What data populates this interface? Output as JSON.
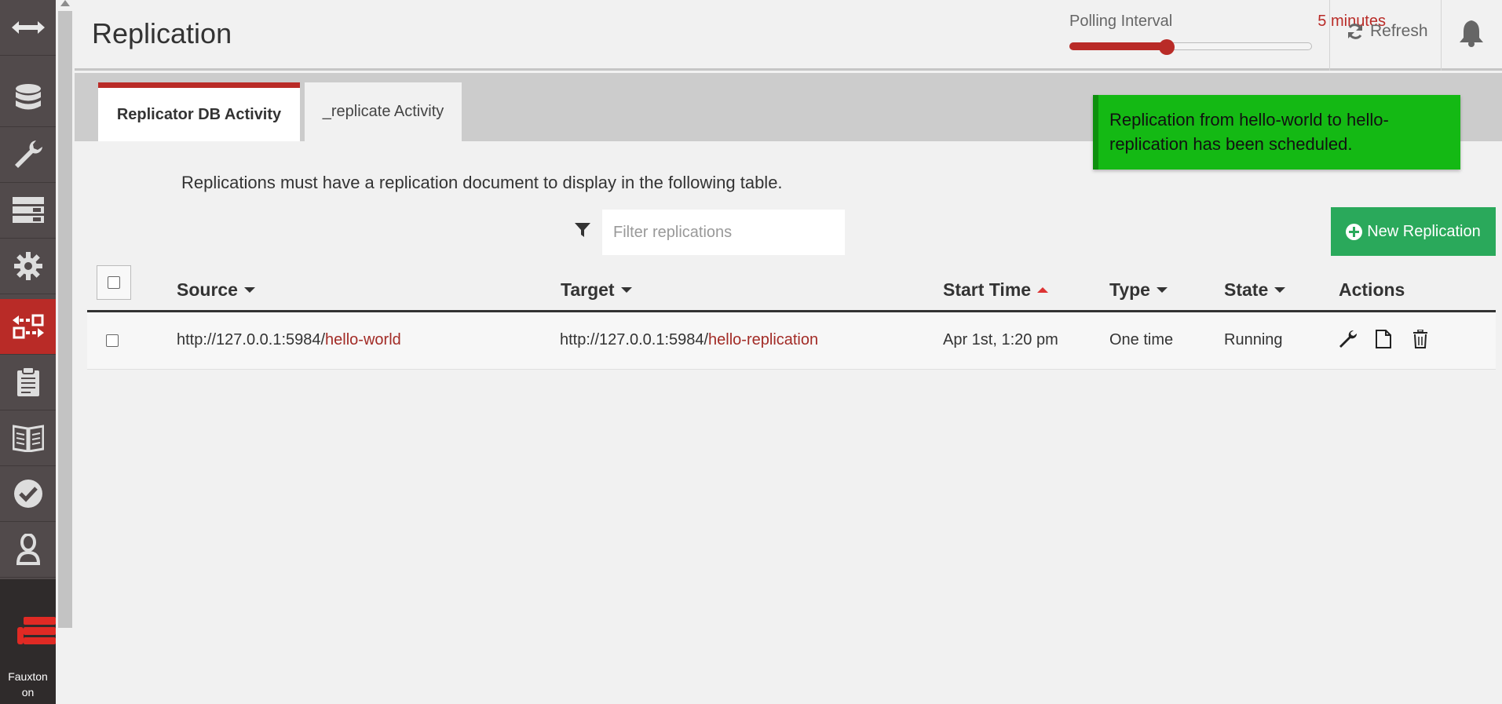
{
  "header": {
    "title": "Replication",
    "polling_label": "Polling Interval",
    "polling_value": "5 minutes",
    "polling_fraction": 0.4,
    "refresh_label": "Refresh"
  },
  "sidebar": {
    "items": [
      {
        "icon": "toggle-width-icon"
      },
      {
        "icon": "databases-icon"
      },
      {
        "icon": "setup-wrench-icon"
      },
      {
        "icon": "active-tasks-icon"
      },
      {
        "icon": "config-gear-icon"
      },
      {
        "icon": "replication-icon",
        "active": true
      },
      {
        "icon": "clipboard-icon"
      },
      {
        "icon": "documentation-icon"
      },
      {
        "icon": "verify-check-icon"
      },
      {
        "icon": "user-icon"
      }
    ],
    "footer_line1": "Fauxton",
    "footer_line2": "on",
    "brand_color": "#b92b27"
  },
  "tabs": {
    "active": "Replicator DB Activity",
    "inactive": "_replicate Activity"
  },
  "toast": {
    "message": "Replication from hello-world to hello-replication has been scheduled.",
    "color": "#14b914"
  },
  "content": {
    "info": "Replications must have a replication document to display in the following table.",
    "filter_placeholder": "Filter replications",
    "new_button": "New Replication"
  },
  "table": {
    "headers": {
      "source": "Source",
      "target": "Target",
      "start_time": "Start Time",
      "type": "Type",
      "state": "State",
      "actions": "Actions"
    },
    "rows": [
      {
        "source_host": "http://127.0.0.1:5984/",
        "source_db": "hello-world",
        "target_host": "http://127.0.0.1:5984/",
        "target_db": "hello-replication",
        "start_time": "Apr 1st, 1:20 pm",
        "type": "One time",
        "state": "Running"
      }
    ]
  }
}
